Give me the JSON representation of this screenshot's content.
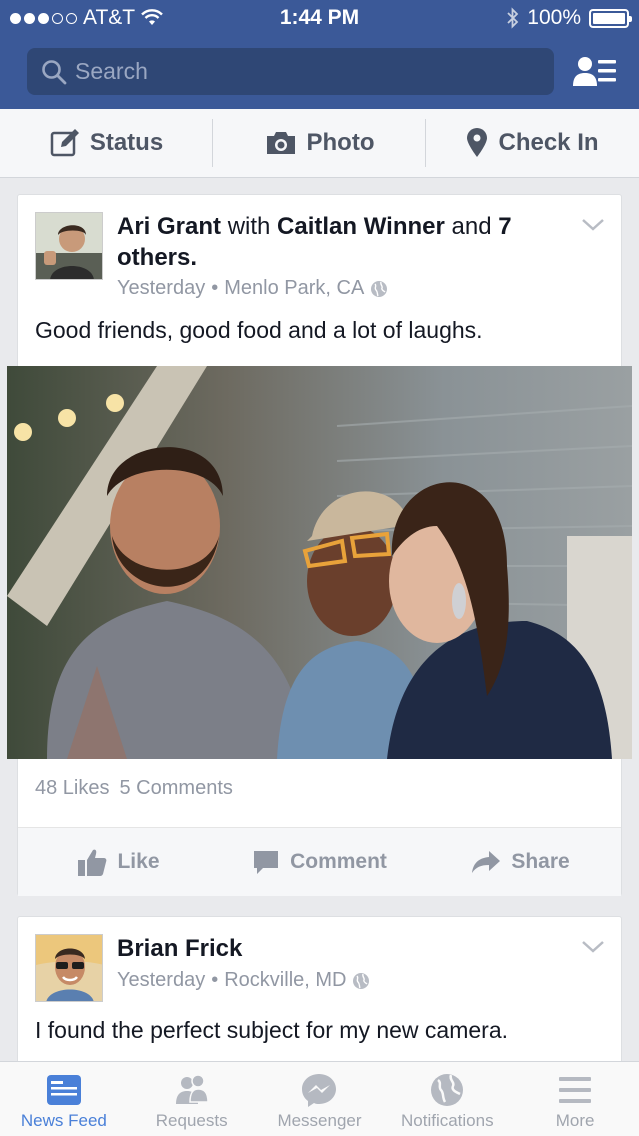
{
  "status_bar": {
    "carrier": "AT&T",
    "time": "1:44 PM",
    "battery": "100%"
  },
  "search": {
    "placeholder": "Search"
  },
  "composer": {
    "status": "Status",
    "photo": "Photo",
    "check_in": "Check In"
  },
  "posts": [
    {
      "author": "Ari Grant",
      "with_word": "with",
      "tagged": "Caitlan Winner",
      "and_word": "and",
      "others": "7 others.",
      "time": "Yesterday",
      "location": "Menlo Park, CA",
      "text": "Good friends, good food and a lot of laughs.",
      "likes": "48 Likes",
      "comments": "5 Comments"
    },
    {
      "author": "Brian Frick",
      "time": "Yesterday",
      "location": "Rockville, MD",
      "text": "I found the perfect subject for my new camera."
    }
  ],
  "actions": {
    "like": "Like",
    "comment": "Comment",
    "share": "Share"
  },
  "tabs": [
    {
      "label": "News Feed",
      "icon": "news-feed-icon",
      "active": true
    },
    {
      "label": "Requests",
      "icon": "requests-icon"
    },
    {
      "label": "Messenger",
      "icon": "messenger-icon"
    },
    {
      "label": "Notifications",
      "icon": "globe-icon"
    },
    {
      "label": "More",
      "icon": "menu-icon"
    }
  ],
  "colors": {
    "brand": "#3b5998",
    "active_tab": "#4a80d8",
    "muted": "#9197a3"
  }
}
